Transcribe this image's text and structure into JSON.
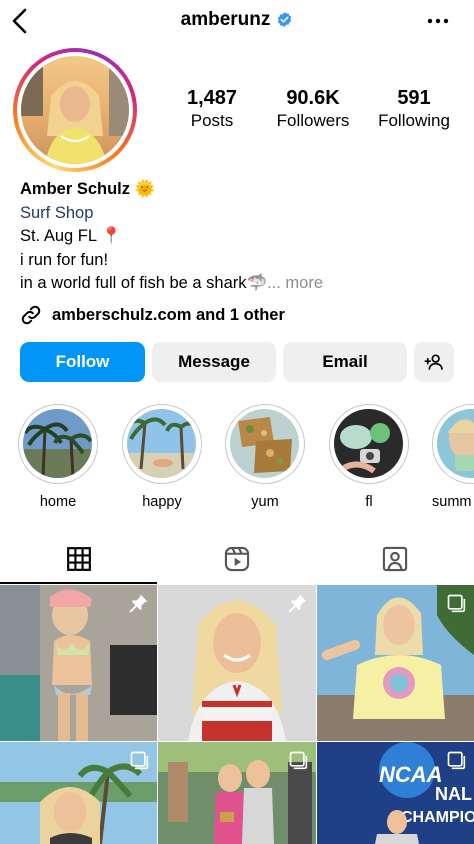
{
  "header": {
    "username": "amberunz",
    "back_icon": "chevron-left-icon",
    "verified_icon": "verified-badge-icon",
    "menu_icon": "more-dots-icon"
  },
  "stats": [
    {
      "value": "1,487",
      "label": "Posts"
    },
    {
      "value": "90.6K",
      "label": "Followers"
    },
    {
      "value": "591",
      "label": "Following"
    }
  ],
  "bio": {
    "name": "Amber Schulz",
    "name_emoji": "🌞",
    "category": "Surf Shop",
    "line1": "St. Aug FL",
    "line1_emoji": "📍",
    "line2": "i run for fun!",
    "line3": "in a world full of fish be a shark",
    "line3_emoji": "🦈",
    "more": "... more"
  },
  "link": {
    "text": "amberschulz.com and 1 other",
    "icon": "link-icon"
  },
  "actions": {
    "follow": "Follow",
    "message": "Message",
    "email": "Email",
    "add_person_icon": "add-person-icon"
  },
  "highlights": [
    {
      "label": "home"
    },
    {
      "label": "happy"
    },
    {
      "label": "yum"
    },
    {
      "label": "fl"
    },
    {
      "label": "summ"
    }
  ],
  "tabs": [
    {
      "name": "grid",
      "icon": "grid-icon",
      "active": true
    },
    {
      "name": "reels",
      "icon": "reels-icon",
      "active": false
    },
    {
      "name": "tagged",
      "icon": "tagged-icon",
      "active": false
    }
  ],
  "posts": [
    {
      "badge": "pin-icon"
    },
    {
      "badge": "pin-icon"
    },
    {
      "badge": "carousel-icon"
    },
    {
      "badge": "carousel-icon"
    },
    {
      "badge": "carousel-icon"
    },
    {
      "badge": "carousel-icon",
      "overlay_text": "NCAA",
      "overlay_text2": "NAL",
      "overlay_text3": "CHAMPIONS"
    }
  ],
  "colors": {
    "accent": "#0095f6",
    "button_gray": "#efefef",
    "category_text": "#1f3a5f",
    "muted": "#8e8e8e"
  }
}
